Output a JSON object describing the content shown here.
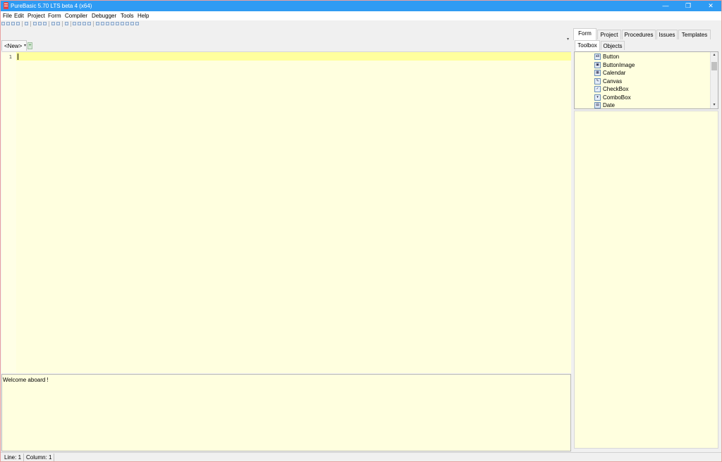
{
  "window": {
    "title": "PureBasic 5.70 LTS beta 4 (x64)",
    "minimize_glyph": "—",
    "restore_glyph": "❐",
    "close_glyph": "✕"
  },
  "menu": [
    "File",
    "Edit",
    "Project",
    "Form",
    "Compiler",
    "Debugger",
    "Tools",
    "Help"
  ],
  "editor": {
    "tab_label": "<New>",
    "tab_dropdown_glyph": "▾",
    "new_tab_glyph": "+",
    "scroll_arrow_glyph": "▾",
    "line_numbers": [
      "1"
    ]
  },
  "log": {
    "message": "Welcome aboard !"
  },
  "right_panel": {
    "tabs": [
      "Form",
      "Project",
      "Procedures",
      "Issues",
      "Templates"
    ],
    "active_tab": "Form",
    "subtabs": [
      "Toolbox",
      "Objects"
    ],
    "active_subtab": "Toolbox",
    "toolbox_items": [
      {
        "label": "Button",
        "icon": "button-icon",
        "glyph": "ab"
      },
      {
        "label": "ButtonImage",
        "icon": "button-image-icon",
        "glyph": "▣"
      },
      {
        "label": "Calendar",
        "icon": "calendar-icon",
        "glyph": "▦"
      },
      {
        "label": "Canvas",
        "icon": "canvas-icon",
        "glyph": "✎"
      },
      {
        "label": "CheckBox",
        "icon": "checkbox-icon",
        "glyph": "✓"
      },
      {
        "label": "ComboBox",
        "icon": "combobox-icon",
        "glyph": "▾"
      },
      {
        "label": "Date",
        "icon": "date-icon",
        "glyph": "▤"
      }
    ],
    "scroll_up_glyph": "▴",
    "scroll_down_glyph": "▾"
  },
  "status": {
    "line": "Line: 1",
    "column": "Column: 1"
  },
  "colors": {
    "titlebar": "#2f9bf3",
    "editor_bg": "#ffffdf",
    "current_line": "#ffff9e"
  }
}
